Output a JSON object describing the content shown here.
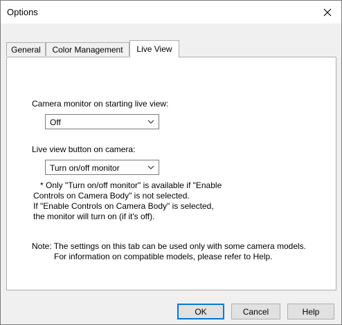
{
  "dialog": {
    "title": "Options"
  },
  "tabs": [
    {
      "label": "General"
    },
    {
      "label": "Color Management"
    },
    {
      "label": "Live View",
      "active": true
    }
  ],
  "live_view": {
    "camera_monitor_label": "Camera monitor on starting live view:",
    "camera_monitor_value": "Off",
    "button_label": "Live view button on camera:",
    "button_value": "Turn on/off monitor",
    "footnote_lines": [
      "* Only \"Turn on/off monitor\" is available if \"Enable",
      "Controls on Camera Body\" is not selected.",
      "If \"Enable Controls on Camera Body\" is selected,",
      "the monitor will turn on (if it's off)."
    ],
    "note_lines": [
      "Note: The settings on this tab can be used only with some camera models.",
      "For information on compatible models, please refer to Help."
    ]
  },
  "buttons": {
    "ok": "OK",
    "cancel": "Cancel",
    "help": "Help"
  },
  "colors": {
    "accent": "#0078d7",
    "window_bg": "#f0f0f0",
    "panel_bg": "#ffffff"
  },
  "icons": {
    "close": "close-icon",
    "dropdown": "chevron-down-icon"
  }
}
